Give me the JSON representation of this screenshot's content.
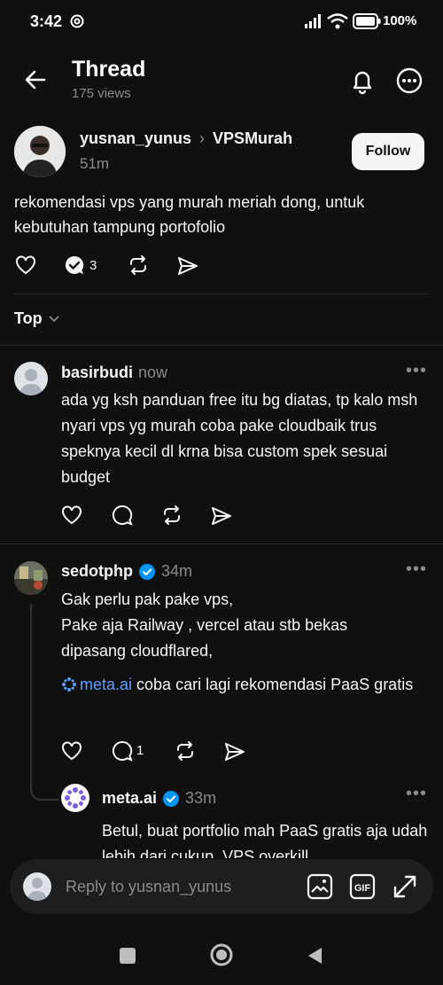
{
  "status": {
    "time": "3:42",
    "battery": "100%"
  },
  "header": {
    "title": "Thread",
    "views": "175 views"
  },
  "post": {
    "author": "yusnan_yunus",
    "separator": "›",
    "topic": "VPSMurah",
    "time": "51m",
    "follow_label": "Follow",
    "text": "rekomendasi vps yang murah meriah dong, untuk kebutuhan tampung portofolio",
    "reply_count": "3"
  },
  "sort": {
    "label": "Top"
  },
  "replies": [
    {
      "author": "basirbudi",
      "time": "now",
      "text": "ada yg ksh panduan free itu bg diatas, tp kalo msh nyari vps yg murah coba pake cloudbaik trus speknya kecil dl krna bisa custom spek sesuai budget"
    },
    {
      "author": "sedotphp",
      "time": "34m",
      "text1": "Gak perlu pak pake vps,",
      "text2": "Pake aja Railway , vercel  atau stb bekas dipasang cloudflared,",
      "mention": "meta.ai",
      "text3": " coba cari lagi rekomendasi  PaaS gratis",
      "reply_count": "1"
    },
    {
      "author": "meta.ai",
      "time": "33m",
      "text": "Betul, buat portfolio mah PaaS gratis aja udah lebih dari cukup. VPS overkill"
    }
  ],
  "compose": {
    "placeholder": "Reply to yusnan_yunus"
  },
  "colors": {
    "background": "#101010",
    "verified": "#0095f6",
    "mention": "#5b9dff",
    "muted": "#8a8a8a"
  }
}
